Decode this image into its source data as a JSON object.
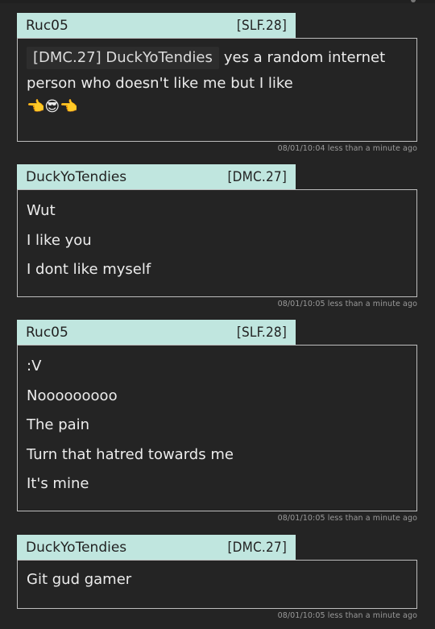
{
  "messages": [
    {
      "author": "Ruc05",
      "tag": "[SLF.28]",
      "mention": "[DMC.27] DuckYoTendies",
      "first_line_rest": "yes a random internet",
      "second_line": "person who doesn't like me but I like",
      "emoji": "👈😎👈",
      "timestamp": "08/01/10:04 less than a minute ago"
    },
    {
      "author": "DuckYoTendies",
      "tag": "[DMC.27]",
      "lines": [
        "Wut",
        "I like you",
        "I dont like myself"
      ],
      "timestamp": "08/01/10:05 less than a minute ago"
    },
    {
      "author": "Ruc05",
      "tag": "[SLF.28]",
      "lines": [
        ":V",
        "Nooooooooo",
        "The pain",
        "Turn that hatred towards me",
        "It's mine"
      ],
      "timestamp": "08/01/10:05 less than a minute ago"
    },
    {
      "author": "DuckYoTendies",
      "tag": "[DMC.27]",
      "lines": [
        "Git gud gamer"
      ],
      "timestamp": "08/01/10:05 less than a minute ago"
    }
  ]
}
